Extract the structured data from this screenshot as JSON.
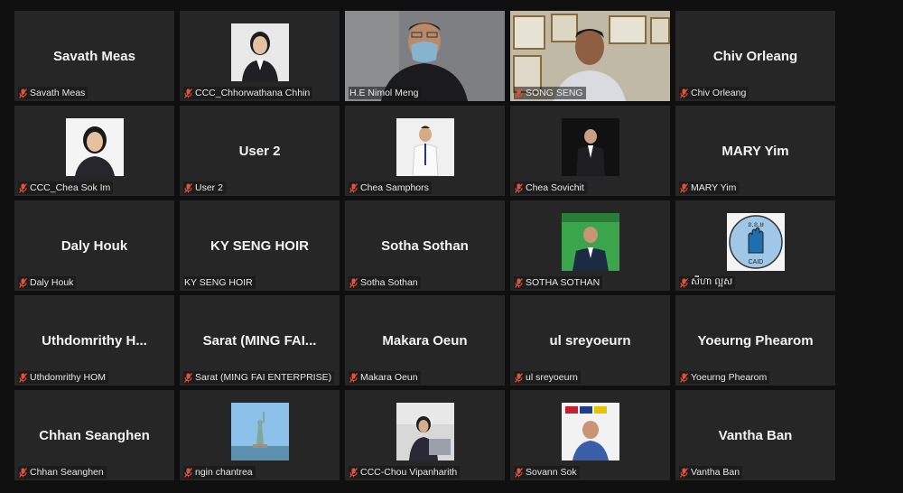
{
  "participants": [
    {
      "name": "Savath Meas",
      "label": "Savath Meas",
      "muted": true,
      "display": "name"
    },
    {
      "name": "",
      "label": "CCC_Chhorwathana Chhin",
      "muted": true,
      "display": "photo",
      "photo": "woman-portrait"
    },
    {
      "name": "",
      "label": "H.E Nimol Meng",
      "muted": false,
      "display": "video",
      "video": "man-masked",
      "active": true
    },
    {
      "name": "",
      "label": "SONG SENG",
      "muted": true,
      "display": "video",
      "video": "man-office"
    },
    {
      "name": "Chiv Orleang",
      "label": "Chiv Orleang",
      "muted": true,
      "display": "name"
    },
    {
      "name": "",
      "label": "CCC_Chea Sok Im",
      "muted": true,
      "display": "photo",
      "photo": "woman-smiling"
    },
    {
      "name": "User 2",
      "label": "User 2",
      "muted": true,
      "display": "name"
    },
    {
      "name": "",
      "label": "Chea Samphors",
      "muted": true,
      "display": "photo",
      "photo": "man-white-shirt"
    },
    {
      "name": "",
      "label": "Chea Sovichit",
      "muted": true,
      "display": "photo",
      "photo": "man-dark-suit"
    },
    {
      "name": "MARY Yim",
      "label": "MARY Yim",
      "muted": true,
      "display": "name"
    },
    {
      "name": "Daly Houk",
      "label": "Daly Houk",
      "muted": true,
      "display": "name"
    },
    {
      "name": "KY SENG HOIR",
      "label": "KY SENG HOIR",
      "muted": false,
      "display": "name"
    },
    {
      "name": "Sotha Sothan",
      "label": "Sotha Sothan",
      "muted": true,
      "display": "name"
    },
    {
      "name": "",
      "label": "SOTHA SOTHAN",
      "muted": true,
      "display": "photo",
      "photo": "man-green-bg"
    },
    {
      "name": "",
      "label": "សីហា ល្អស",
      "muted": true,
      "display": "photo",
      "photo": "caid-logo"
    },
    {
      "name": "Uthdomrithy  H...",
      "label": "Uthdomrithy HOM",
      "muted": true,
      "display": "name"
    },
    {
      "name": "Sarat  (MING FAI...",
      "label": "Sarat (MING FAI ENTERPRISE)",
      "muted": true,
      "display": "name"
    },
    {
      "name": "Makara Oeun",
      "label": "Makara Oeun",
      "muted": true,
      "display": "name"
    },
    {
      "name": "ul sreyoeurn",
      "label": "ul sreyoeurn",
      "muted": true,
      "display": "name"
    },
    {
      "name": "Yoeurng Phearom",
      "label": "Yoeurng Phearom",
      "muted": true,
      "display": "name"
    },
    {
      "name": "Chhan Seanghen",
      "label": "Chhan Seanghen",
      "muted": true,
      "display": "name"
    },
    {
      "name": "",
      "label": "ngin chantrea",
      "muted": true,
      "display": "photo",
      "photo": "statue-of-liberty"
    },
    {
      "name": "",
      "label": "CCC-Chou Vipanharith",
      "muted": true,
      "display": "photo",
      "photo": "woman-laptop"
    },
    {
      "name": "",
      "label": "Sovann Sok",
      "muted": true,
      "display": "photo",
      "photo": "man-flags"
    },
    {
      "name": "Vantha Ban",
      "label": "Vantha Ban",
      "muted": true,
      "display": "name"
    }
  ],
  "logo_text": {
    "top": "ខ.ខ.ម",
    "bottom": "CAID"
  },
  "colors": {
    "tile": "#262626",
    "background": "#0f0f0f",
    "mic_muted": "#e0533a",
    "active_border": "#d8d860"
  }
}
